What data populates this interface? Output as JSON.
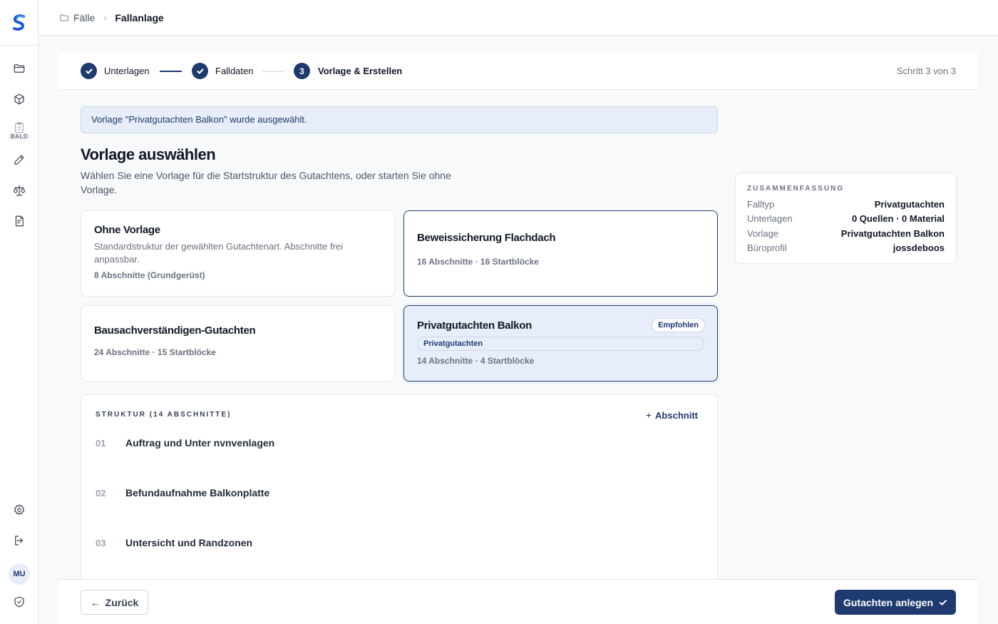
{
  "breadcrumb": {
    "parent": "Fälle",
    "current": "Fallanlage"
  },
  "sidebar": {
    "soon_badge": "BALD",
    "avatar": "MU",
    "icons": [
      "folder-icon",
      "box-icon",
      "clipboard-icon",
      "pen-icon",
      "scale-icon",
      "document-icon",
      "gear-icon",
      "logout-icon",
      "shield-icon"
    ]
  },
  "stepper": {
    "steps": [
      {
        "label": "Unterlagen",
        "state": "done"
      },
      {
        "label": "Falldaten",
        "state": "done"
      },
      {
        "label": "Vorlage & Erstellen",
        "state": "current",
        "number": "3"
      }
    ],
    "counter": "Schritt 3 von 3"
  },
  "banner": "Vorlage \"Privatgutachten Balkon\" wurde ausgewählt.",
  "heading": "Vorlage auswählen",
  "subtext": "Wählen Sie eine Vorlage für die Startstruktur des Gutachtens, oder starten Sie ohne Vorlage.",
  "templates": [
    {
      "title": "Ohne Vorlage",
      "description": "Standardstruktur der gewählten Gutachtenart. Abschnitte frei anpassbar.",
      "meta": "8 Abschnitte (Grundgerüst)"
    },
    {
      "title": "Beweissicherung Flachdach",
      "meta": "16 Abschnitte · 16 Startblöcke"
    },
    {
      "title": "Bausachverständigen-Gutachten",
      "meta": "24 Abschnitte · 15 Startblöcke"
    },
    {
      "title": "Privatgutachten Balkon",
      "badge": "Empfohlen",
      "tag": "Privatgutachten",
      "meta": "14 Abschnitte · 4 Startblöcke"
    }
  ],
  "summary": {
    "title": "ZUSAMMENFASSUNG",
    "rows": [
      {
        "key": "Falltyp",
        "value": "Privatgutachten"
      },
      {
        "key": "Unterlagen",
        "value": "0 Quellen · 0 Material"
      },
      {
        "key": "Vorlage",
        "value": "Privatgutachten Balkon"
      },
      {
        "key": "Büroprofil",
        "value": "jossdeboos"
      }
    ]
  },
  "structure": {
    "title": "STRUKTUR (14 ABSCHNITTE)",
    "add_label": "Abschnitt",
    "sections": [
      {
        "num": "01",
        "name": "Auftrag und Unter nvnvenlagen"
      },
      {
        "num": "02",
        "name": "Befundaufnahme Balkonplatte"
      },
      {
        "num": "03",
        "name": "Untersicht und Randzonen"
      }
    ]
  },
  "footer": {
    "back": "Zurück",
    "create": "Gutachten anlegen"
  },
  "colors": {
    "primary": "#1e3a6e",
    "selected_bg": "#e8eef9",
    "border": "#e5e7eb"
  }
}
